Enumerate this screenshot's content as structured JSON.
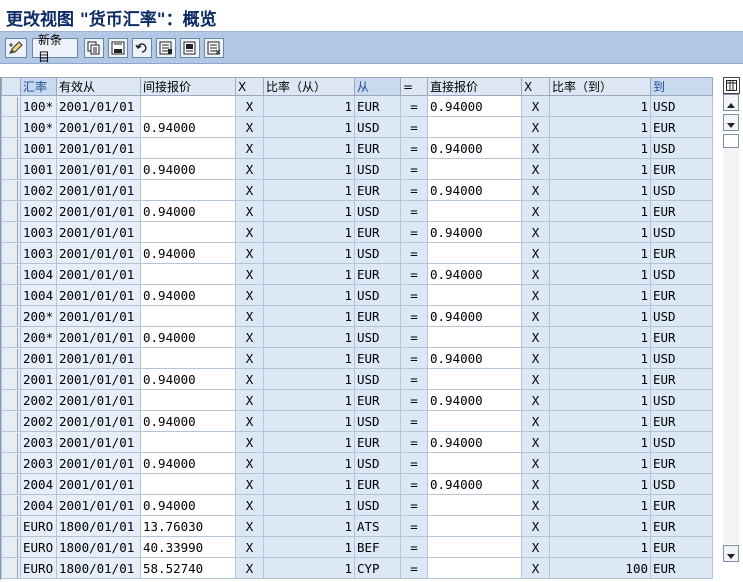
{
  "title": "更改视图 \"货币汇率\"：概览",
  "toolbar": {
    "new_entries_label": "新条目",
    "buttons": [
      "edit-pencil-icon",
      "copy-icon",
      "save-icon",
      "undo-icon",
      "select-all-icon",
      "select-block-icon",
      "deselect-all-icon"
    ]
  },
  "columns": [
    "汇率",
    "有效从",
    "间接报价",
    "X",
    "比率（从）",
    "从",
    "=",
    "直接报价",
    "X",
    "比率（到）",
    "到"
  ],
  "rows": [
    [
      "100*",
      "2001/01/01",
      "",
      "X",
      "1",
      "EUR",
      "=",
      "0.94000",
      "X",
      "1",
      "USD"
    ],
    [
      "100*",
      "2001/01/01",
      "0.94000",
      "X",
      "1",
      "USD",
      "=",
      "",
      "X",
      "1",
      "EUR"
    ],
    [
      "1001",
      "2001/01/01",
      "",
      "X",
      "1",
      "EUR",
      "=",
      "0.94000",
      "X",
      "1",
      "USD"
    ],
    [
      "1001",
      "2001/01/01",
      "0.94000",
      "X",
      "1",
      "USD",
      "=",
      "",
      "X",
      "1",
      "EUR"
    ],
    [
      "1002",
      "2001/01/01",
      "",
      "X",
      "1",
      "EUR",
      "=",
      "0.94000",
      "X",
      "1",
      "USD"
    ],
    [
      "1002",
      "2001/01/01",
      "0.94000",
      "X",
      "1",
      "USD",
      "=",
      "",
      "X",
      "1",
      "EUR"
    ],
    [
      "1003",
      "2001/01/01",
      "",
      "X",
      "1",
      "EUR",
      "=",
      "0.94000",
      "X",
      "1",
      "USD"
    ],
    [
      "1003",
      "2001/01/01",
      "0.94000",
      "X",
      "1",
      "USD",
      "=",
      "",
      "X",
      "1",
      "EUR"
    ],
    [
      "1004",
      "2001/01/01",
      "",
      "X",
      "1",
      "EUR",
      "=",
      "0.94000",
      "X",
      "1",
      "USD"
    ],
    [
      "1004",
      "2001/01/01",
      "0.94000",
      "X",
      "1",
      "USD",
      "=",
      "",
      "X",
      "1",
      "EUR"
    ],
    [
      "200*",
      "2001/01/01",
      "",
      "X",
      "1",
      "EUR",
      "=",
      "0.94000",
      "X",
      "1",
      "USD"
    ],
    [
      "200*",
      "2001/01/01",
      "0.94000",
      "X",
      "1",
      "USD",
      "=",
      "",
      "X",
      "1",
      "EUR"
    ],
    [
      "2001",
      "2001/01/01",
      "",
      "X",
      "1",
      "EUR",
      "=",
      "0.94000",
      "X",
      "1",
      "USD"
    ],
    [
      "2001",
      "2001/01/01",
      "0.94000",
      "X",
      "1",
      "USD",
      "=",
      "",
      "X",
      "1",
      "EUR"
    ],
    [
      "2002",
      "2001/01/01",
      "",
      "X",
      "1",
      "EUR",
      "=",
      "0.94000",
      "X",
      "1",
      "USD"
    ],
    [
      "2002",
      "2001/01/01",
      "0.94000",
      "X",
      "1",
      "USD",
      "=",
      "",
      "X",
      "1",
      "EUR"
    ],
    [
      "2003",
      "2001/01/01",
      "",
      "X",
      "1",
      "EUR",
      "=",
      "0.94000",
      "X",
      "1",
      "USD"
    ],
    [
      "2003",
      "2001/01/01",
      "0.94000",
      "X",
      "1",
      "USD",
      "=",
      "",
      "X",
      "1",
      "EUR"
    ],
    [
      "2004",
      "2001/01/01",
      "",
      "X",
      "1",
      "EUR",
      "=",
      "0.94000",
      "X",
      "1",
      "USD"
    ],
    [
      "2004",
      "2001/01/01",
      "0.94000",
      "X",
      "1",
      "USD",
      "=",
      "",
      "X",
      "1",
      "EUR"
    ],
    [
      "EURO",
      "1800/01/01",
      "13.76030",
      "X",
      "1",
      "ATS",
      "=",
      "",
      "X",
      "1",
      "EUR"
    ],
    [
      "EURO",
      "1800/01/01",
      "40.33990",
      "X",
      "1",
      "BEF",
      "=",
      "",
      "X",
      "1",
      "EUR"
    ],
    [
      "EURO",
      "1800/01/01",
      "58.52740",
      "X",
      "1",
      "CYP",
      "=",
      "",
      "X",
      "100",
      "EUR"
    ]
  ],
  "colors": {
    "accent": "#0c2a66",
    "toolbar": "#b4c8e6",
    "key_header": "#1f4e9c"
  }
}
